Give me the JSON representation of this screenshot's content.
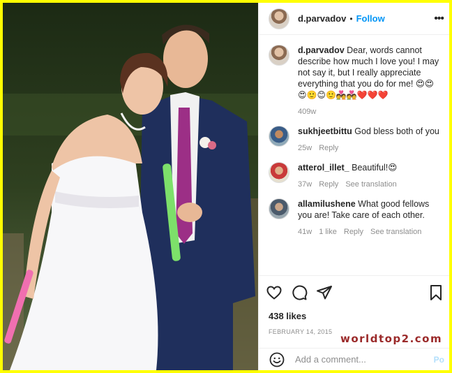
{
  "post": {
    "username": "d.parvadov",
    "separator": "•",
    "follow_label": "Follow",
    "more_label": "•••"
  },
  "comments": [
    {
      "username": "d.parvadov",
      "text": "Dear, words cannot describe how much I love you! I may not say it, but I really appreciate everything that you do for me! 😍😍",
      "emojis": "😍🙂😊🙂💑💑❤️❤️❤️",
      "time": "409w"
    },
    {
      "username": "sukhjeetbittu",
      "text": "God bless both of you",
      "time": "25w",
      "reply": "Reply"
    },
    {
      "username": "atterol_illet_",
      "text": "Beautiful!😍",
      "time": "37w",
      "reply": "Reply",
      "translation": "See translation"
    },
    {
      "username": "allamilushene",
      "text": "What good fellows you are! Take care of each other.",
      "time": "41w",
      "likes": "1 like",
      "reply": "Reply",
      "translation": "See translation"
    }
  ],
  "actions": {
    "likes": "438 likes",
    "date": "FEBRUARY 14, 2015"
  },
  "add_comment": {
    "placeholder": "Add a comment...",
    "post_label": "Po"
  },
  "watermark": "worldtop2.com",
  "icons": [
    "heart-icon",
    "comment-icon",
    "share-icon",
    "bookmark-icon",
    "emoji-icon",
    "more-icon"
  ],
  "colors": {
    "accent": "#0095f6",
    "frame": "#ffff00",
    "muted": "#8e8e8e"
  }
}
